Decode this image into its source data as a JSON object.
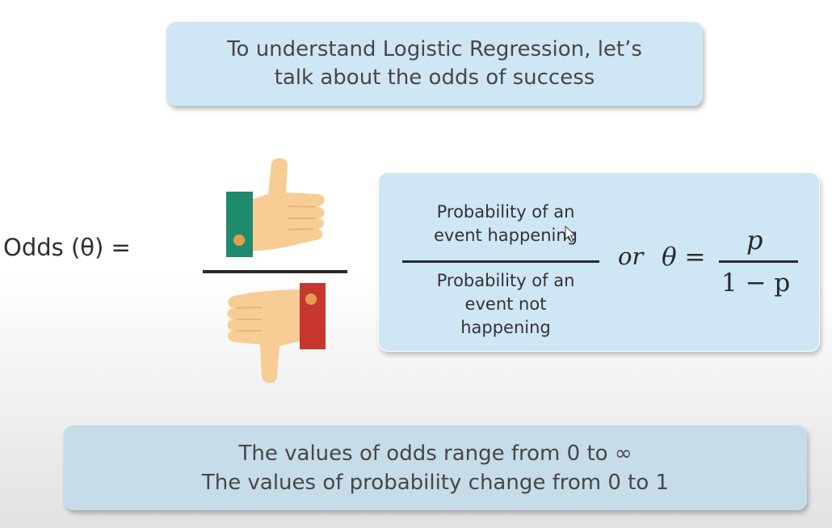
{
  "header": {
    "line1": "To understand Logistic Regression, let’s",
    "line2": "talk about the odds of success"
  },
  "odds": {
    "label": "Odds (θ) ="
  },
  "fraction": {
    "numerator": [
      "Probability of an",
      "event happening"
    ],
    "denominator": [
      "Probability of an",
      "event not",
      "happening"
    ]
  },
  "formula": {
    "or": "or",
    "theta": "θ",
    "equals": "=",
    "numerator": "p",
    "denominator": "1 − p"
  },
  "footer": {
    "line1": "The values of odds range from 0 to ∞",
    "line2": "The values of probability change from 0 to 1"
  },
  "icons": [
    "thumbs-up-icon",
    "thumbs-down-icon",
    "cursor-icon"
  ],
  "colors": {
    "box_blue": "#cfe6f5",
    "footer_blue": "#c7dce9",
    "sleeve_green": "#1f8a6e",
    "sleeve_red": "#c8372d",
    "skin": "#f8cc95",
    "button": "#e2a04f"
  }
}
